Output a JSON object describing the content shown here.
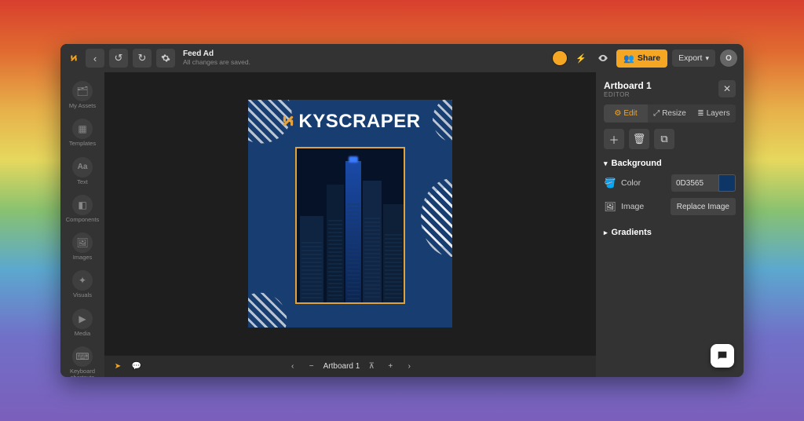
{
  "topbar": {
    "doc_title": "Feed Ad",
    "save_status": "All changes are saved.",
    "share_label": "Share",
    "export_label": "Export",
    "avatar_initial": "O"
  },
  "sidebar": {
    "items": [
      {
        "label": "My Assets",
        "icon": "folder-icon"
      },
      {
        "label": "Templates",
        "icon": "templates-icon"
      },
      {
        "label": "Text",
        "icon": "text-icon"
      },
      {
        "label": "Components",
        "icon": "components-icon"
      },
      {
        "label": "Images",
        "icon": "image-icon"
      },
      {
        "label": "Visuals",
        "icon": "visuals-icon"
      },
      {
        "label": "Media",
        "icon": "media-icon"
      },
      {
        "label": "Keyboard shortcuts",
        "icon": "keyboard-icon"
      }
    ]
  },
  "canvas": {
    "artboard_headline": "KYSCRAPER",
    "bottom_artboard_label": "Artboard 1"
  },
  "panel": {
    "title": "Artboard 1",
    "subtitle": "EDITOR",
    "tabs": {
      "edit": "Edit",
      "resize": "Resize",
      "layers": "Layers"
    },
    "sections": {
      "background": {
        "title": "Background",
        "color_label": "Color",
        "color_value": "0D3565",
        "image_label": "Image",
        "replace_label": "Replace Image"
      },
      "gradients": {
        "title": "Gradients"
      }
    }
  },
  "colors": {
    "accent": "#f5a623",
    "artboard_bg": "#183d70",
    "frame_border": "#e0a23b"
  }
}
